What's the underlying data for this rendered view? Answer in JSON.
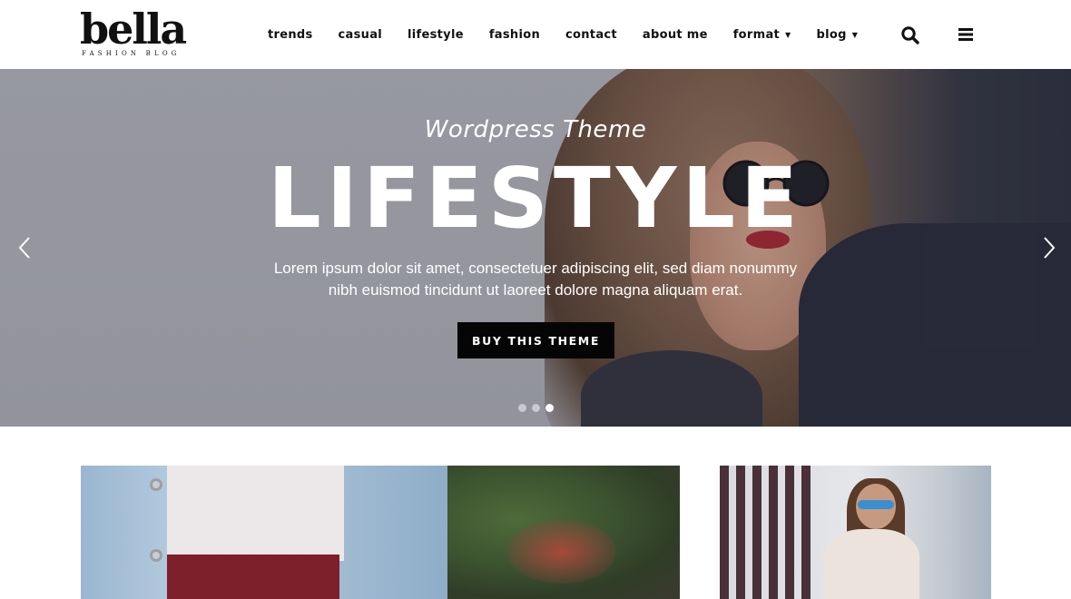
{
  "header": {
    "logo": {
      "word": "bella",
      "tagline": "FASHION BLOG"
    },
    "nav": [
      {
        "label": "trends",
        "dropdown": false
      },
      {
        "label": "casual",
        "dropdown": false
      },
      {
        "label": "lifestyle",
        "dropdown": false
      },
      {
        "label": "fashion",
        "dropdown": false
      },
      {
        "label": "contact",
        "dropdown": false
      },
      {
        "label": "about me",
        "dropdown": false
      },
      {
        "label": "format",
        "dropdown": true
      },
      {
        "label": "blog",
        "dropdown": true
      }
    ],
    "icons": {
      "search": "search-icon",
      "menu": "hamburger-menu-icon"
    }
  },
  "hero": {
    "subtitle": "Wordpress Theme",
    "title": "LIFESTYLE",
    "text_line1": "Lorem ipsum dolor sit amet, consectetuer adipiscing elit, sed diam nonummy",
    "text_line2": "nibh euismod tincidunt ut laoreet dolore magna aliquam erat.",
    "cta": "BUY THIS THEME",
    "slides": 3,
    "active_slide": 3,
    "arrows": {
      "prev": "chevron-left-icon",
      "next": "chevron-right-icon"
    }
  },
  "colors": {
    "cta_bg": "#050505",
    "text_dark": "#111111",
    "hero_text": "#ffffff"
  }
}
